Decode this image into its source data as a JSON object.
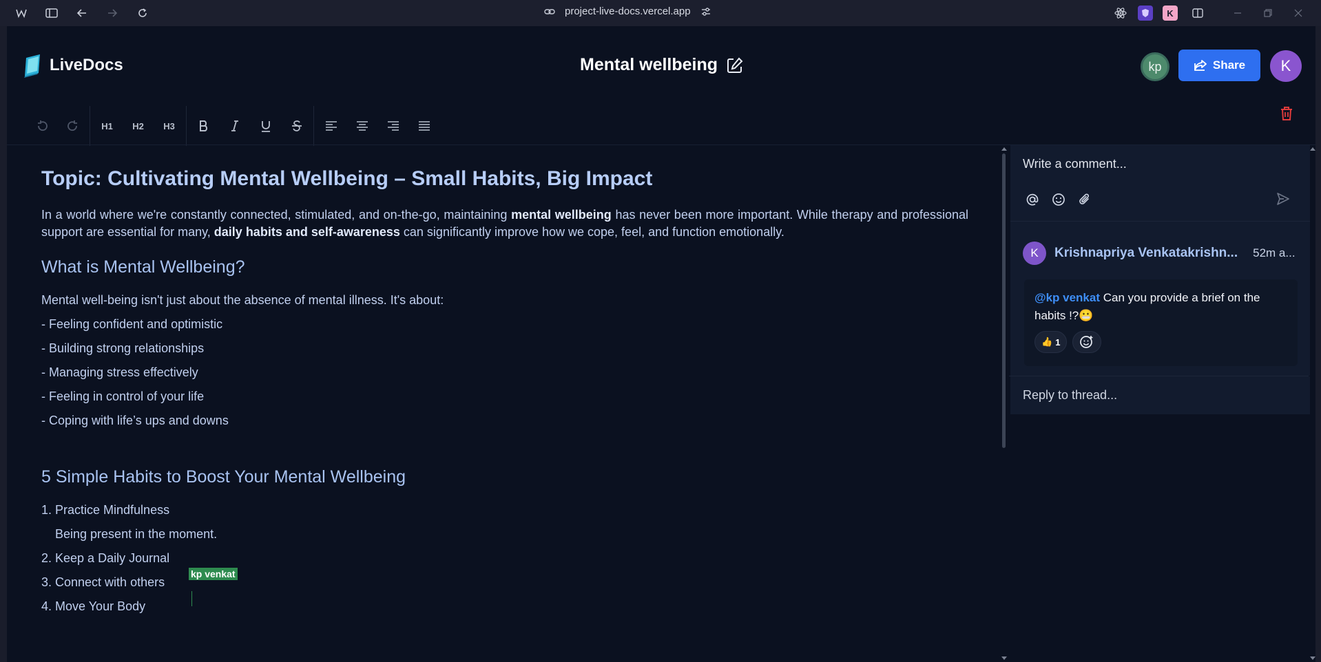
{
  "browser": {
    "url": "project-live-docs.vercel.app"
  },
  "app": {
    "name": "LiveDocs",
    "doc_title": "Mental wellbeing",
    "collaborator_initials": "kp",
    "share_label": "Share",
    "user_initial": "K"
  },
  "toolbar": {
    "h1": "H1",
    "h2": "H2",
    "h3": "H3"
  },
  "document": {
    "title": "Topic: Cultivating Mental Wellbeing – Small Habits, Big Impact",
    "intro": {
      "t1": "In a world where we're constantly connected, stimulated, and on-the-go, maintaining ",
      "b1": "mental wellbeing",
      "t2": " has never been more important. While therapy and professional support are essential for many, ",
      "b2": "daily habits and self-awareness",
      "t3": " can significantly improve how we cope, feel, and function emotionally."
    },
    "section1_heading": "What is Mental Wellbeing?",
    "section1_lines": [
      "Mental well-being isn't just about the absence of mental illness. It's about:",
      "- Feeling confident and optimistic",
      "- Building strong relationships",
      "- Managing stress effectively",
      "- Feeling in control of your life",
      "- Coping with life’s ups and downs"
    ],
    "section2_heading": "5 Simple Habits to Boost Your Mental Wellbeing",
    "section2_lines": [
      "1. Practice Mindfulness",
      "Being present in the moment.",
      "2. Keep a Daily Journal",
      "3. Connect with others",
      "4. Move Your Body"
    ],
    "cursor_label": "kp venkat"
  },
  "comments": {
    "placeholder": "Write a comment...",
    "author_initial": "K",
    "author": "Krishnapriya Venkatakrishn...",
    "time": "52m a...",
    "mention": "@kp venkat",
    "text": " Can you provide a brief on the habits !?",
    "emoji": "😬",
    "reaction_emoji": "👍",
    "reaction_count": "1",
    "reply_placeholder": "Reply to thread..."
  }
}
